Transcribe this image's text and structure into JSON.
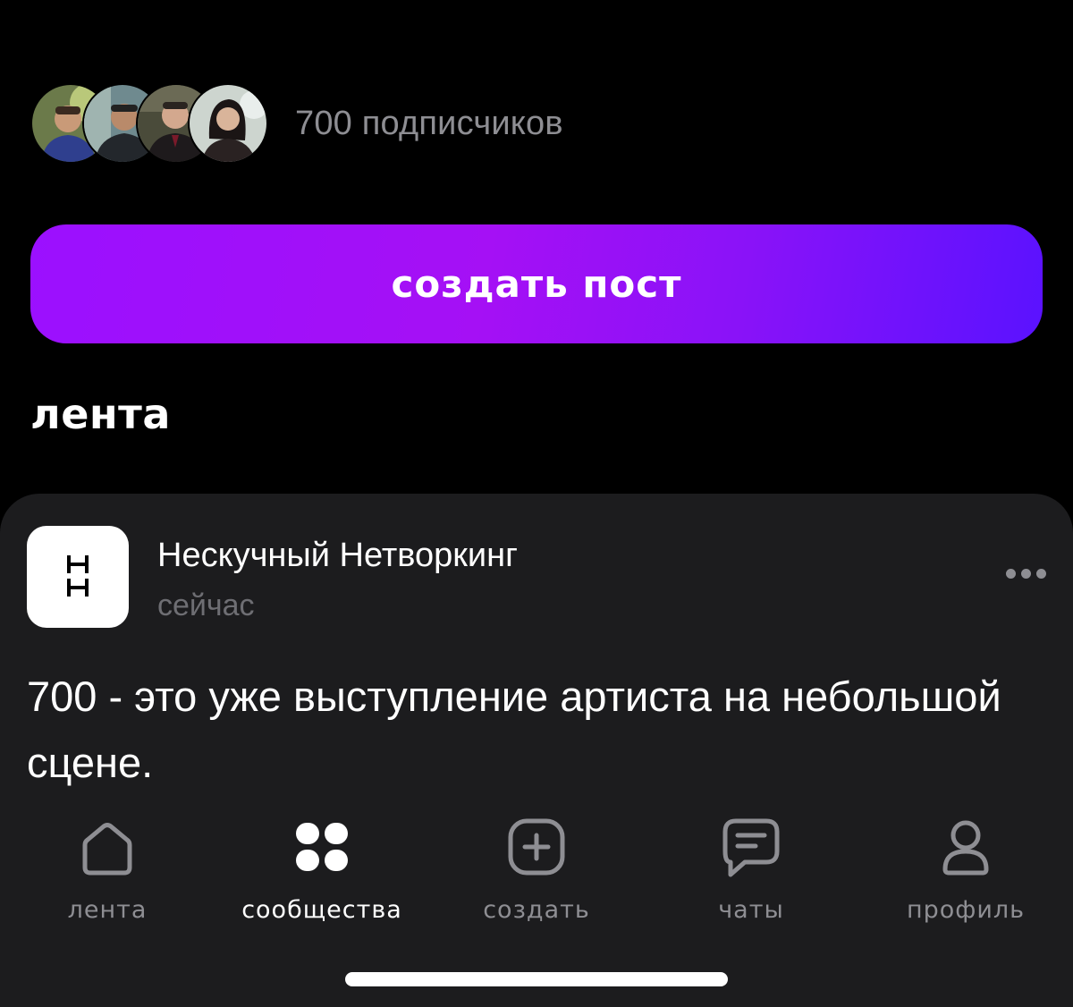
{
  "subscribers": {
    "avatars": [
      "avatar-1",
      "avatar-2",
      "avatar-3",
      "avatar-4"
    ],
    "count_text": "700 подписчиков"
  },
  "create_post": {
    "label": "создать пост"
  },
  "feed": {
    "title": "лента"
  },
  "post": {
    "logo_text": "НН",
    "author": "Нескучный Нетворкинг",
    "time": "сейчас",
    "text": "700 - это уже выступление артиста на небольшой сцене.",
    "more_icon": "more-icon"
  },
  "nav": {
    "items": [
      {
        "label": "лента",
        "icon": "home-icon"
      },
      {
        "label": "сообщества",
        "icon": "grid-icon",
        "active": true
      },
      {
        "label": "создать",
        "icon": "plus-square-icon"
      },
      {
        "label": "чаты",
        "icon": "chat-icon"
      },
      {
        "label": "профиль",
        "icon": "person-icon"
      }
    ]
  },
  "colors": {
    "accent_gradient_start": "#9b10ff",
    "accent_gradient_end": "#5a12ff",
    "card_bg": "#1c1c1e",
    "muted_text": "#8e8e93"
  }
}
